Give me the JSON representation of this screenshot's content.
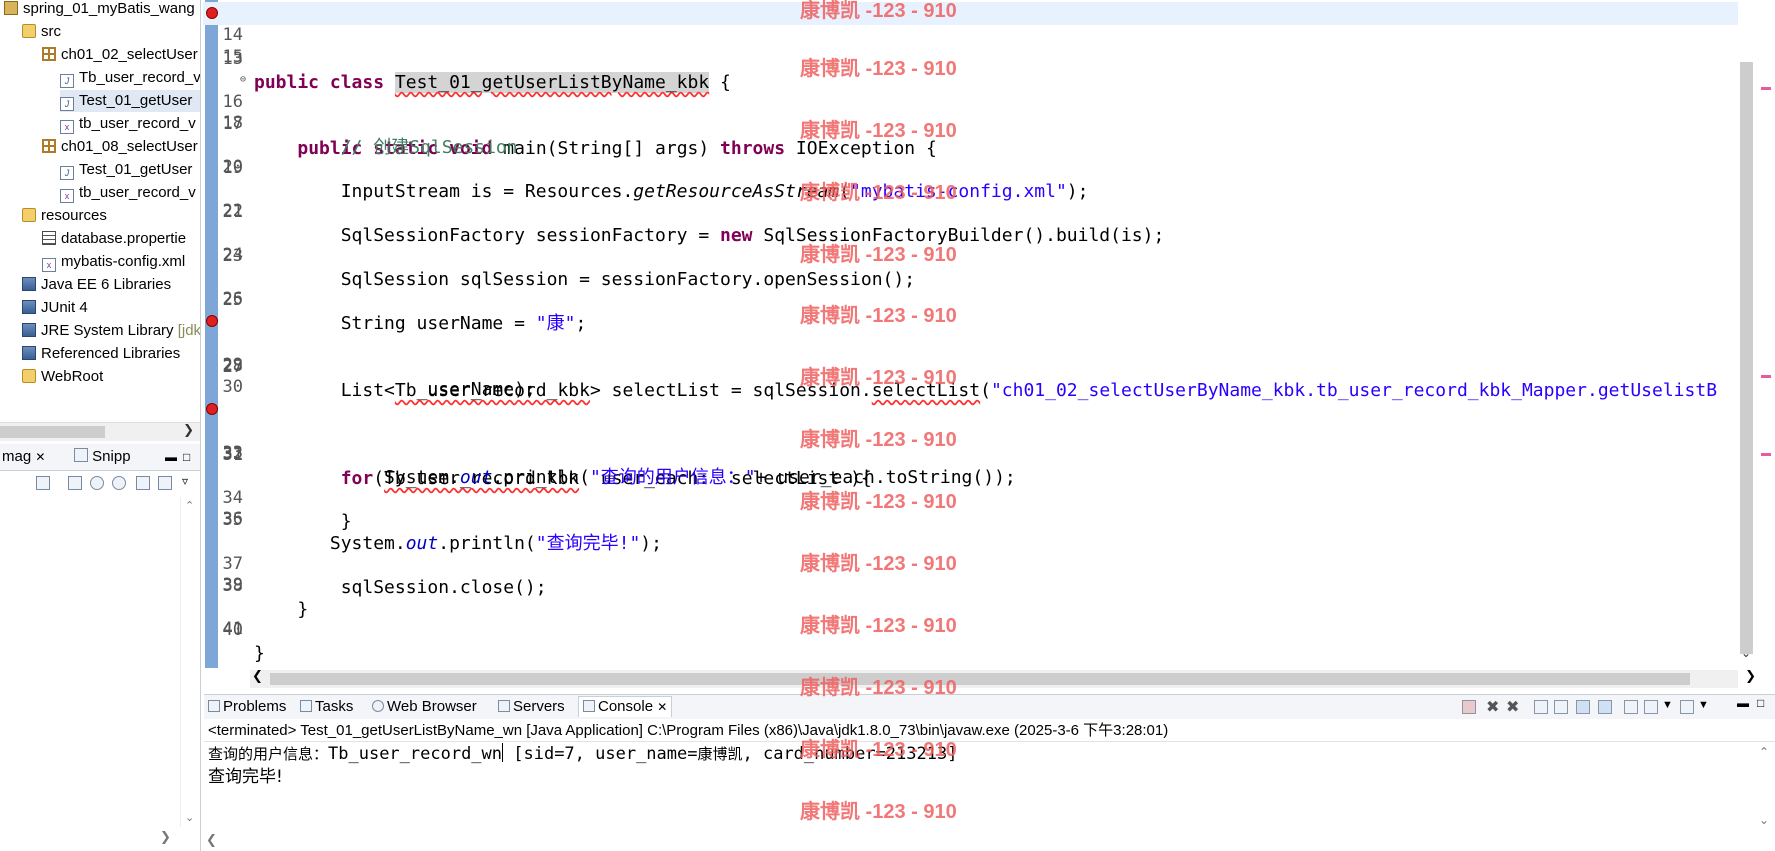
{
  "explorer": {
    "items": [
      {
        "label": "spring_01_myBatis_wang",
        "icon": "project-icon"
      },
      {
        "label": "src",
        "icon": "source-folder-icon"
      },
      {
        "label": "ch01_02_selectUser",
        "icon": "package-icon"
      },
      {
        "label": "Tb_user_record_v",
        "icon": "java-file-icon"
      },
      {
        "label": "Test_01_getUser",
        "icon": "java-file-icon"
      },
      {
        "label": "tb_user_record_v",
        "icon": "xml-file-icon"
      },
      {
        "label": "ch01_08_selectUser",
        "icon": "package-icon"
      },
      {
        "label": "Test_01_getUser",
        "icon": "java-file-icon"
      },
      {
        "label": "tb_user_record_v",
        "icon": "xml-file-icon"
      },
      {
        "label": "resources",
        "icon": "source-folder-icon"
      },
      {
        "label": "database.propertie",
        "icon": "properties-file-icon"
      },
      {
        "label": "mybatis-config.xml",
        "icon": "xml-file-icon"
      },
      {
        "label": "Java EE 6 Libraries",
        "icon": "library-icon"
      },
      {
        "label": "JUnit 4",
        "icon": "library-icon"
      },
      {
        "label": "JRE System Library",
        "suffix": "[jdk",
        "icon": "library-icon"
      },
      {
        "label": "Referenced Libraries",
        "icon": "library-icon"
      },
      {
        "label": "WebRoot",
        "icon": "folder-icon"
      }
    ],
    "mini_tabs": {
      "image": "mag",
      "snippets": "Snipp"
    }
  },
  "editor": {
    "line_numbers": [
      "13",
      "14",
      "15",
      "16",
      "17",
      "18",
      "19",
      "20",
      "21",
      "22",
      "23",
      "24",
      "25",
      "26",
      "27",
      "28",
      "29",
      "30",
      "31",
      "32",
      "33",
      "34",
      "35",
      "36",
      "37",
      "38",
      "39",
      "40",
      "41"
    ],
    "class_name": "Test_01_getUserListByName_kbk",
    "comment": "// 创建SqlSession",
    "config_file": "\"mybatis-config.xml\"",
    "user_name_value": "\"康\"",
    "mapper_stmt": "\"ch01_02_selectUserByName_kbk.tb_user_record_kbk_Mapper.getUselistB",
    "println_prefix": "\"查询的用户信息：\"",
    "println_done": "\"查询完毕!\"",
    "watermark": "康博凯 -123 - 910"
  },
  "console": {
    "tabs": [
      "Problems",
      "Tasks",
      "Web Browser",
      "Servers",
      "Console"
    ],
    "status": "<terminated> Test_01_getUserListByName_wn [Java Application] C:\\Program Files (x86)\\Java\\jdk1.8.0_73\\bin\\javaw.exe (2025-3-6 下午3:28:01)",
    "out_prefix": "查询的用户信息：",
    "out_class": "Tb_user_record_wn",
    "out_rest1": " [sid=7, user_name=",
    "out_name": "康博凯",
    "out_rest2": ", card_number=213213]",
    "out_done": "查询完毕!"
  }
}
